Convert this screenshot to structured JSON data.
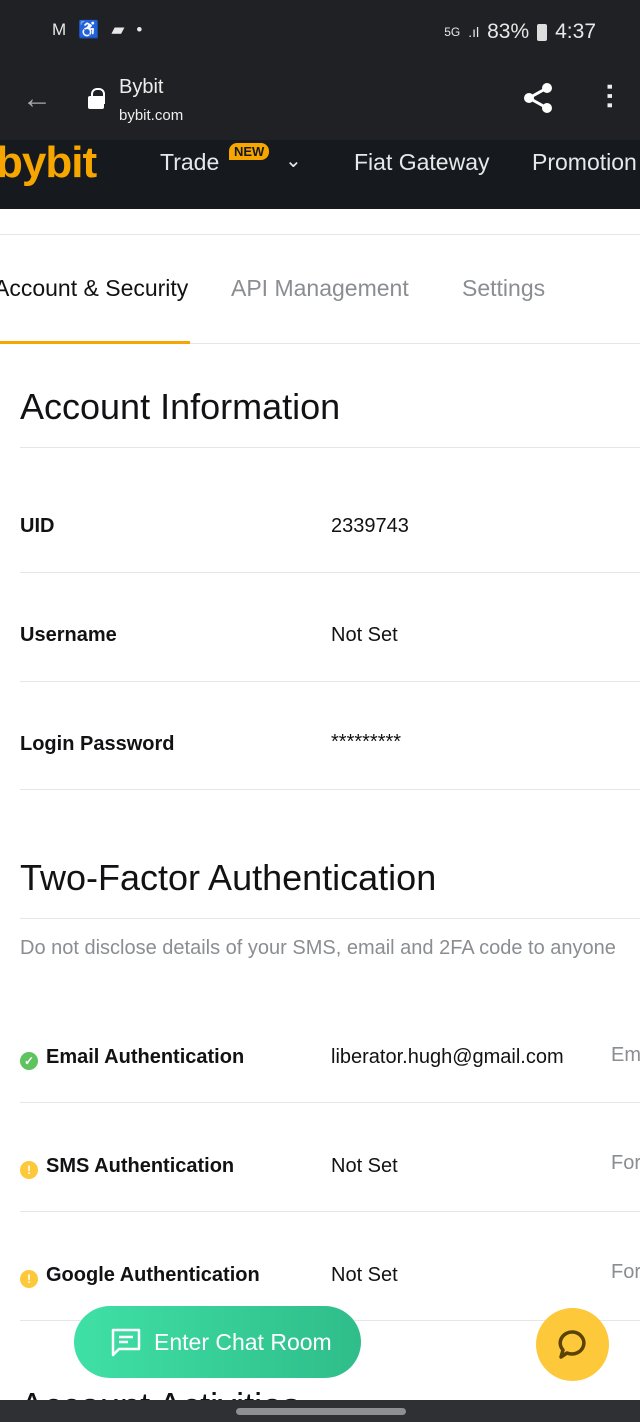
{
  "status_bar": {
    "icons": [
      "gmail-icon",
      "accessibility-icon",
      "message-icon",
      "dot-icon"
    ],
    "network": "5G",
    "battery": "83%",
    "time": "4:37"
  },
  "browser": {
    "title": "Bybit",
    "domain": "bybit.com"
  },
  "nav": {
    "logo": "bybit",
    "items": [
      {
        "label": "Trade",
        "badge": "NEW"
      },
      {
        "label": "Fiat Gateway"
      },
      {
        "label": "Promotion"
      }
    ]
  },
  "tabs": [
    {
      "label": "Account & Security",
      "active": true
    },
    {
      "label": "API Management"
    },
    {
      "label": "Settings"
    }
  ],
  "account": {
    "title": "Account Information",
    "rows": [
      {
        "label": "UID",
        "value": "2339743"
      },
      {
        "label": "Username",
        "value": "Not Set"
      },
      {
        "label": "Login Password",
        "value": "*********"
      }
    ]
  },
  "twofa": {
    "title": "Two-Factor Authentication",
    "note": "Do not disclose details of your SMS, email and 2FA code to anyone",
    "rows": [
      {
        "label": "Email Authentication",
        "value": "liberator.hugh@gmail.com",
        "extra": "Em",
        "status": "verified",
        "color": "#5fc35f"
      },
      {
        "label": "SMS Authentication",
        "value": "Not Set",
        "extra": "For",
        "status": "warning",
        "color": "#fdc83a"
      },
      {
        "label": "Google Authentication",
        "value": "Not Set",
        "extra": "For",
        "status": "warning",
        "color": "#fdc83a"
      }
    ]
  },
  "next_section": "Account Activities",
  "chat_button": "Enter Chat Room",
  "colors": {
    "accent": "#f7a600",
    "chat": "#35cf97",
    "help": "#fdc83a"
  }
}
